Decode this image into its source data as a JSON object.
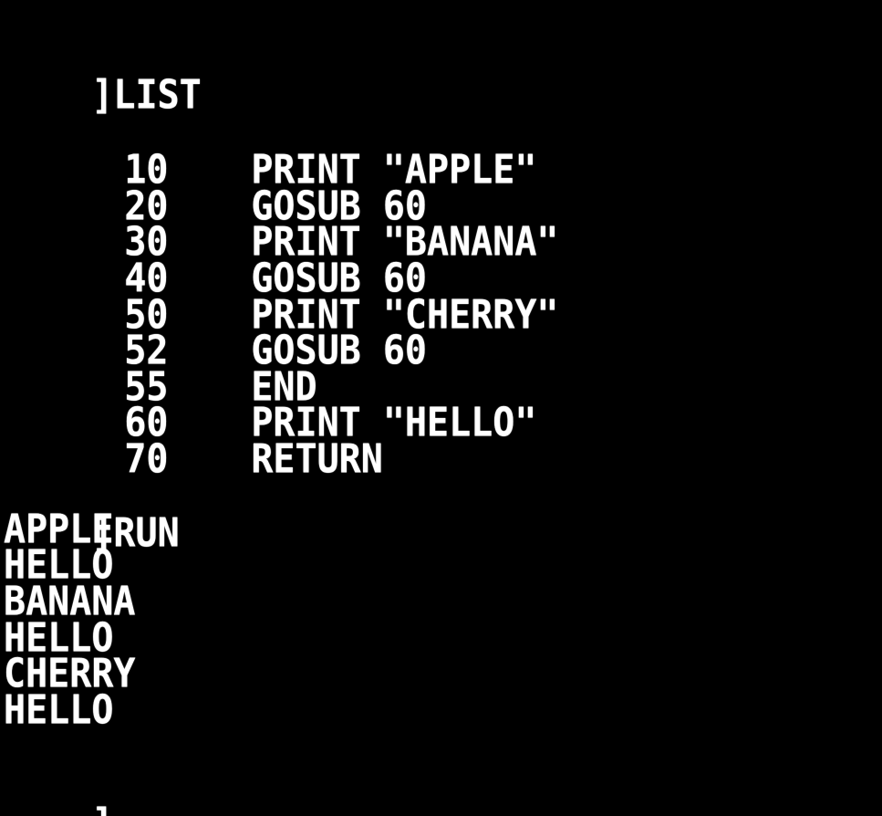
{
  "terminal": {
    "prompt_char": "]",
    "list_command": "LIST",
    "program": [
      {
        "num": "10",
        "stmt": "PRINT \"APPLE\""
      },
      {
        "num": "20",
        "stmt": "GOSUB 60"
      },
      {
        "num": "30",
        "stmt": "PRINT \"BANANA\""
      },
      {
        "num": "40",
        "stmt": "GOSUB 60"
      },
      {
        "num": "50",
        "stmt": "PRINT \"CHERRY\""
      },
      {
        "num": "52",
        "stmt": "GOSUB 60"
      },
      {
        "num": "55",
        "stmt": "END"
      },
      {
        "num": "60",
        "stmt": "PRINT \"HELLO\""
      },
      {
        "num": "70",
        "stmt": "RETURN"
      }
    ],
    "run_command": "RUN",
    "output": [
      "APPLE",
      "HELLO",
      "BANANA",
      "HELLO",
      "CHERRY",
      "HELLO"
    ]
  },
  "colors": {
    "background": "#000000",
    "text": "#ffffff"
  }
}
